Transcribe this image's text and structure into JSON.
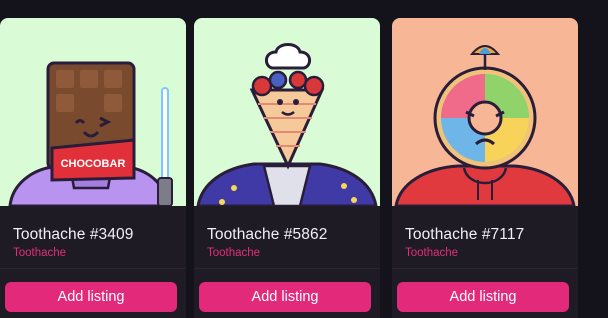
{
  "cards": [
    {
      "title": "Toothache #3409",
      "collection": "Toothache",
      "button_label": "Add listing",
      "art_text": "CHOCOBAR",
      "bg_color": "#d9fbd5",
      "icon": "chocobar-character-art"
    },
    {
      "title": "Toothache #5862",
      "collection": "Toothache",
      "button_label": "Add listing",
      "bg_color": "#d9fbd5",
      "icon": "crepe-chef-character-art"
    },
    {
      "title": "Toothache #7117",
      "collection": "Toothache",
      "button_label": "Add listing",
      "bg_color": "#f7b695",
      "icon": "donut-umbrella-character-art"
    }
  ],
  "colors": {
    "page_bg": "#14121a",
    "card_bg": "#1e1b24",
    "accent": "#e2297a",
    "collection_text": "#e0307a"
  }
}
